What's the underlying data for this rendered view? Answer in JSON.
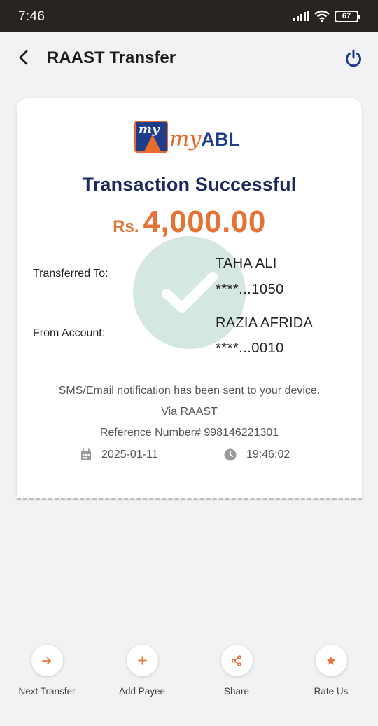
{
  "status_bar": {
    "time": "7:46",
    "battery": "67"
  },
  "header": {
    "title": "RAAST Transfer",
    "back_icon": "chevron-left-icon",
    "power_icon": "power-icon"
  },
  "receipt": {
    "logo": {
      "my": "my",
      "abl": "ABL",
      "badge_text": "my"
    },
    "title": "Transaction Successful",
    "currency": "Rs.",
    "amount": "4,000.00",
    "transferred_to_label": "Transferred To:",
    "transferred_to_name": "TAHA ALI",
    "transferred_to_account": "****...1050",
    "from_account_label": "From Account:",
    "from_account_name": "RAZIA AFRIDA",
    "from_account_number": "****...0010",
    "notification": "SMS/Email notification has been sent to your device.",
    "via": "Via RAAST",
    "reference": "Reference Number# 998146221301",
    "date": "2025-01-11",
    "time": "19:46:02"
  },
  "actions": [
    {
      "label": "Next Transfer",
      "icon": "arrow-right-icon"
    },
    {
      "label": "Add Payee",
      "icon": "plus-icon"
    },
    {
      "label": "Share",
      "icon": "share-icon"
    },
    {
      "label": "Rate Us",
      "icon": "star-icon"
    }
  ],
  "colors": {
    "accent": "#e57335",
    "navy": "#1b2a5e",
    "success": "#d4e8df"
  }
}
